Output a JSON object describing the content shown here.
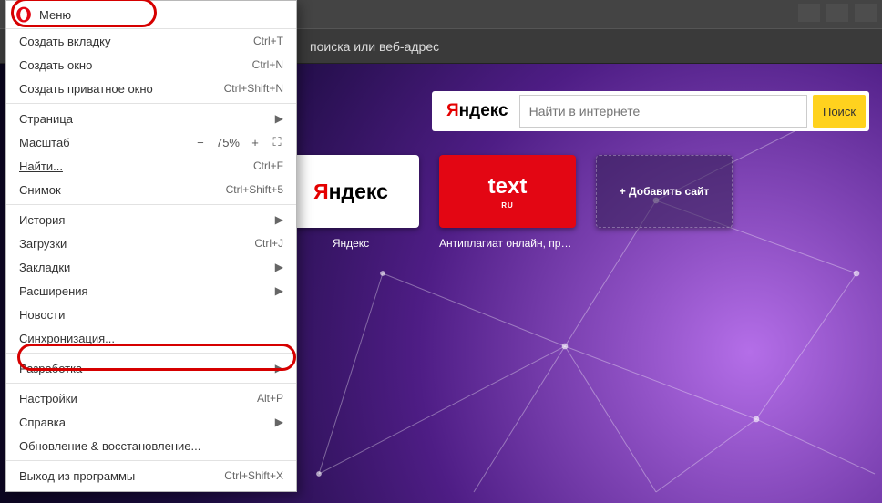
{
  "addressbar": {
    "placeholder_tail": "поиска или веб-адрес"
  },
  "search": {
    "logo_text": "ндекс",
    "placeholder": "Найти в интернете",
    "button": "Поиск"
  },
  "tiles": {
    "yandex": {
      "thumb": "ндекс",
      "caption": "Яндекс"
    },
    "text": {
      "thumb": "text",
      "small": "RU",
      "caption": "Антиплагиат онлайн, провер..."
    },
    "add": {
      "label": "+ Добавить сайт"
    }
  },
  "menu": {
    "title": "Меню",
    "items": {
      "new_tab": {
        "label": "Создать вкладку",
        "shortcut": "Ctrl+T"
      },
      "new_window": {
        "label": "Создать окно",
        "shortcut": "Ctrl+N"
      },
      "new_private": {
        "label": "Создать приватное окно",
        "shortcut": "Ctrl+Shift+N"
      },
      "page": {
        "label": "Страница"
      },
      "zoom": {
        "label": "Масштаб",
        "value": "75%"
      },
      "find": {
        "label": "Найти...",
        "shortcut": "Ctrl+F"
      },
      "snapshot": {
        "label": "Снимок",
        "shortcut": "Ctrl+Shift+5"
      },
      "history": {
        "label": "История"
      },
      "downloads": {
        "label": "Загрузки",
        "shortcut": "Ctrl+J"
      },
      "bookmarks": {
        "label": "Закладки"
      },
      "extensions": {
        "label": "Расширения"
      },
      "news": {
        "label": "Новости"
      },
      "sync": {
        "label": "Синхронизация..."
      },
      "dev": {
        "label": "Разработка"
      },
      "settings": {
        "label": "Настройки",
        "shortcut": "Alt+P"
      },
      "help": {
        "label": "Справка"
      },
      "update": {
        "label": "Обновление & восстановление..."
      },
      "exit": {
        "label": "Выход из программы",
        "shortcut": "Ctrl+Shift+X"
      }
    }
  }
}
